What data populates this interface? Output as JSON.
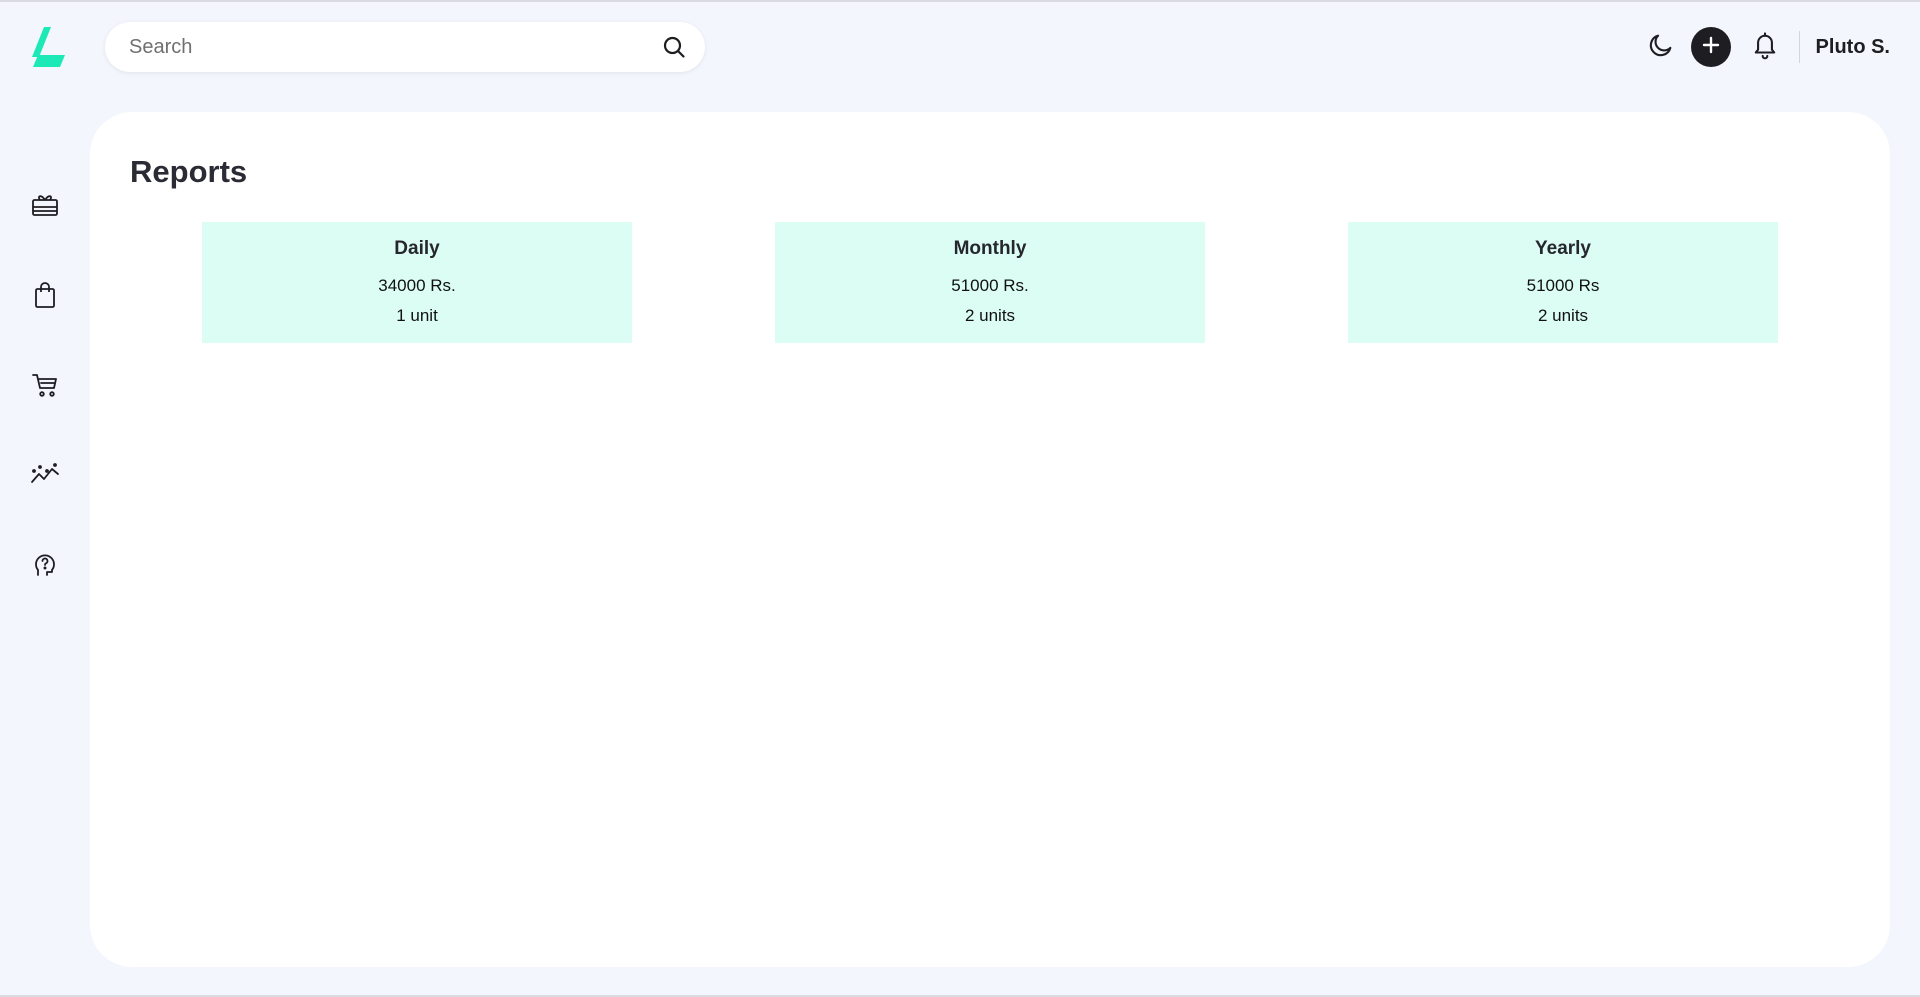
{
  "colors": {
    "accent": "#1de9b6",
    "background": "#f3f6fc",
    "card_background": "#dcfdf4",
    "dark": "#1d1d22"
  },
  "search": {
    "placeholder": "Search",
    "value": ""
  },
  "header": {
    "user_name": "Pluto S.",
    "icons": [
      "moon-icon",
      "plus-icon",
      "bell-icon"
    ]
  },
  "sidebar": {
    "items": [
      {
        "icon": "gift-card-icon"
      },
      {
        "icon": "shopping-bag-icon"
      },
      {
        "icon": "cart-icon"
      },
      {
        "icon": "analytics-icon"
      },
      {
        "icon": "support-icon"
      }
    ]
  },
  "page": {
    "title": "Reports"
  },
  "reports": [
    {
      "title": "Daily",
      "amount": "34000 Rs.",
      "units": "1 unit"
    },
    {
      "title": "Monthly",
      "amount": "51000 Rs.",
      "units": "2 units"
    },
    {
      "title": "Yearly",
      "amount": "51000 Rs",
      "units": "2 units"
    }
  ]
}
